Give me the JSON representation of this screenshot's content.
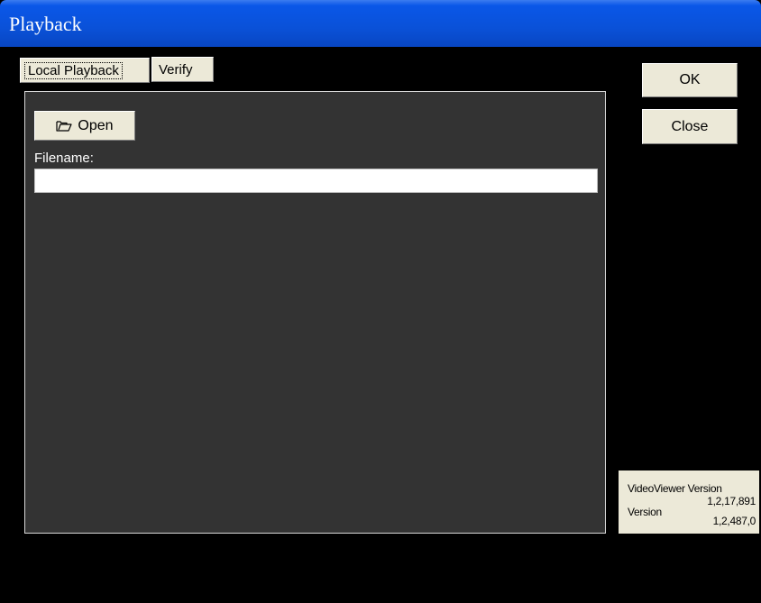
{
  "window": {
    "title": "Playback"
  },
  "tabs": [
    {
      "label": "Local Playback",
      "active": true
    },
    {
      "label": "Verify",
      "active": false
    }
  ],
  "panel": {
    "open_button": {
      "label": "Open",
      "icon": "folder-open-icon"
    },
    "filename": {
      "label": "Filename:",
      "value": "",
      "placeholder": ""
    }
  },
  "buttons": {
    "ok_label": "OK",
    "close_label": "Close"
  },
  "version_info": {
    "videoviewer_label": "VideoViewer Version",
    "videoviewer_value": "1,2,17,891",
    "version_label": "Version",
    "version_value": "1,2,487,0"
  },
  "colors": {
    "titlebar": "#0a51d8",
    "background": "#000000",
    "panel": "#333333",
    "button_face": "#ece9d8"
  }
}
